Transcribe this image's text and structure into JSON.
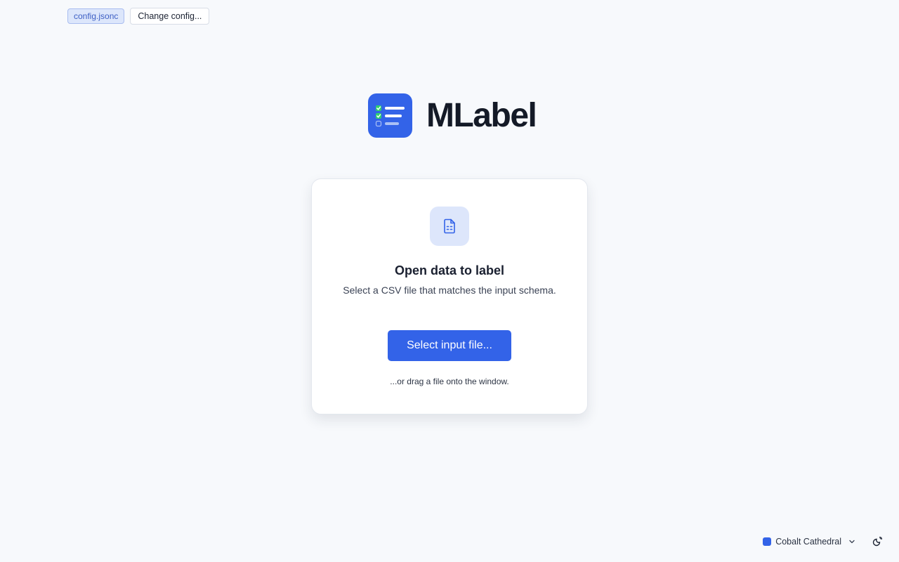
{
  "topbar": {
    "config_file": "config.jsonc",
    "change_config_label": "Change config..."
  },
  "brand": {
    "name": "MLabel",
    "logo_icon": "checklist-icon"
  },
  "card": {
    "icon": "document-icon",
    "title": "Open data to label",
    "subtitle": "Select a CSV file that matches the input schema.",
    "button_label": "Select input file...",
    "drag_hint": "...or drag a file onto the window."
  },
  "footer": {
    "theme_name": "Cobalt Cathedral",
    "theme_color": "#3363e8",
    "mode_icon": "sun-moon-icon"
  },
  "colors": {
    "accent": "#3363e8",
    "background": "#f7f9fc"
  }
}
